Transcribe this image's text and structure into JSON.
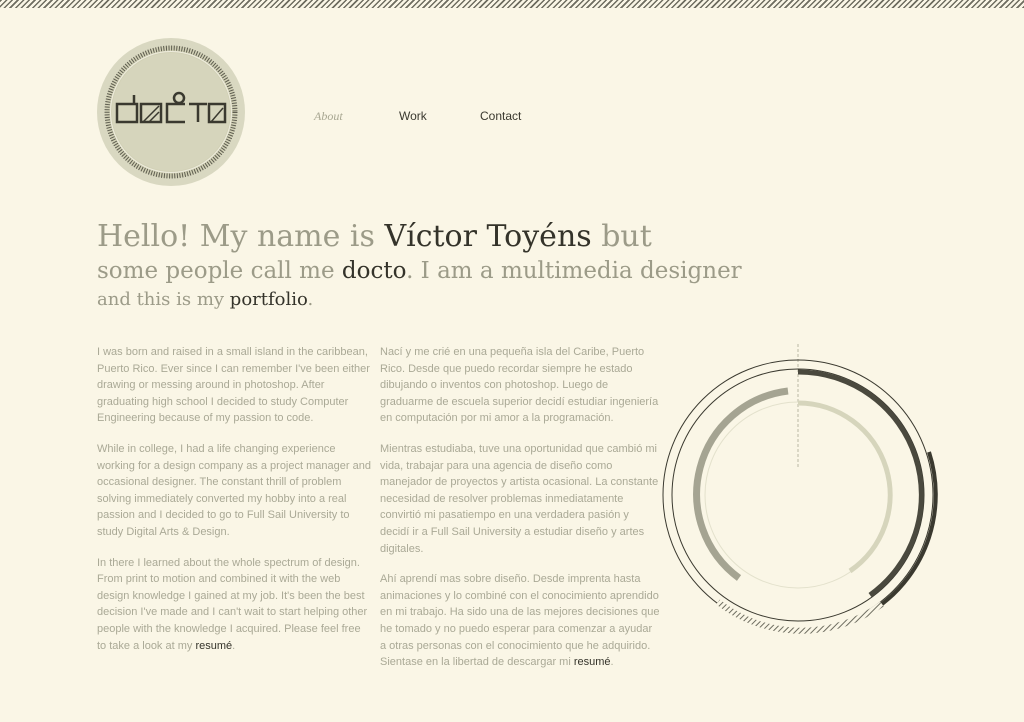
{
  "logo": {
    "text": "docto"
  },
  "nav": [
    {
      "label": "About",
      "active": true
    },
    {
      "label": "Work",
      "active": false
    },
    {
      "label": "Contact",
      "active": false
    }
  ],
  "headline": {
    "l1_pre": "Hello! My name is ",
    "name": "Víctor Toyéns",
    "l1_post": " but",
    "l2_pre": "some people call me ",
    "nickname": "docto",
    "l2_post": ". I am a multimedia designer",
    "l3_pre": "and this is my ",
    "portfolio": "portfolio",
    "l3_post": "."
  },
  "english": {
    "p1": "I was born and raised in a small island in the caribbean, Puerto Rico. Ever since I can remember I've been either drawing or messing around in photoshop. After graduating high school I decided to study Computer Engineering because of my passion to code.",
    "p2": "While in college, I had a life changing experience working for a design company as a project manager and occasional designer. The constant thrill of problem solving immediately converted my hobby into a real passion and I decided to go to Full Sail University to study Digital Arts & Design.",
    "p3": "In there I learned about the whole spectrum of design. From print to motion and combined it with the web design knowledge I gained at my job. It's been the best decision I've made and I can't wait to start helping other people with the knowledge I acquired. Please feel free to take a look at my ",
    "resume_link": "resumé",
    "p3_end": "."
  },
  "spanish": {
    "p1": "Nací y me crié en una pequeña isla del Caribe, Puerto Rico. Desde que puedo recordar siempre he estado dibujando o inventos con photoshop. Luego de graduarme de escuela superior decidí estudiar ingeniería en computación por mi amor a la programación.",
    "p2": "Mientras estudiaba, tuve una oportunidad que cambió mi vida, trabajar para una agencia de diseño como manejador de proyectos y artista ocasional. La constante necesidad de resolver problemas inmediatamente convirtió mi pasatiempo en una verdadera pasión y decidí ir a Full Sail University a estudiar diseño y artes digitales.",
    "p3": "Ahí aprendí mas sobre diseño. Desde imprenta hasta animaciones y lo combiné con el conocimiento aprendido en mi trabajo. Ha sido una de las mejores decisiones que he tomado y no puedo esperar para comenzar a ayudar a otras personas con el conocimiento que he adquirido. Sientase en la libertad de descargar mi ",
    "resume_link": "resumé",
    "p3_end": "."
  },
  "colors": {
    "background": "#faf6e6",
    "dark": "#34332a",
    "muted": "#9c9b88",
    "body_text": "#aaa996",
    "ring_light": "#d6d5bc"
  }
}
